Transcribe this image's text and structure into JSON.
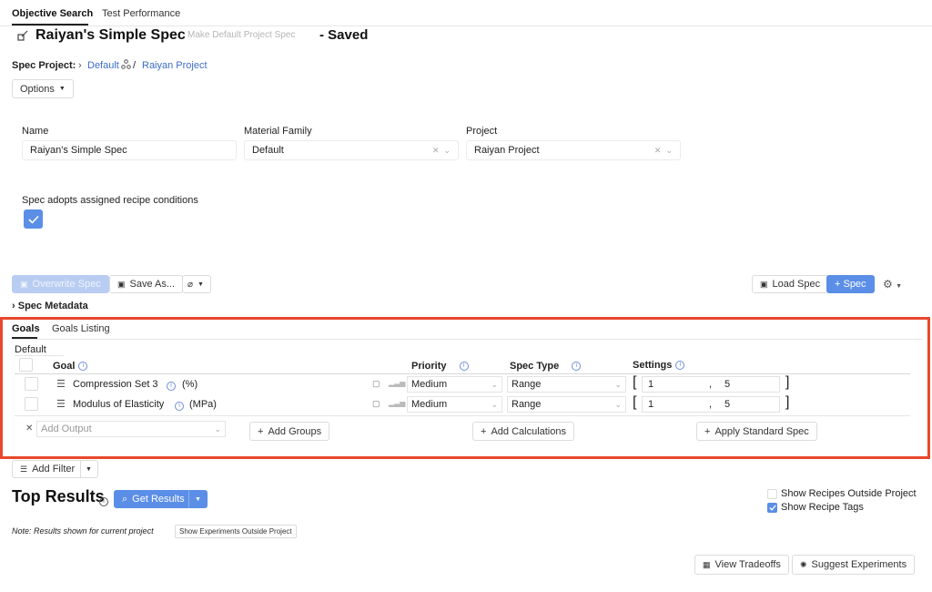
{
  "tabs": [
    {
      "label": "Objective Search",
      "active": true
    },
    {
      "label": "Test Performance",
      "active": false
    }
  ],
  "header": {
    "title": "Raiyan's Simple Spec",
    "make_default": "Make Default Project Spec",
    "saved": "- Saved"
  },
  "breadcrumb": {
    "label": "Spec Project:",
    "default": "Default",
    "separator": "/",
    "project": "Raiyan Project"
  },
  "options_label": "Options",
  "form": {
    "name_label": "Name",
    "name_value": "Raiyan's Simple Spec",
    "material_label": "Material Family",
    "material_value": "Default",
    "project_label": "Project",
    "project_value": "Raiyan Project",
    "adopt_label": "Spec adopts assigned recipe conditions",
    "adopt_checked": true
  },
  "toolbar": {
    "overwrite": "Overwrite Spec",
    "save_as": "Save As...",
    "load": "Load Spec",
    "add_spec": "+ Spec"
  },
  "metadata_label": "Spec Metadata",
  "goals": {
    "tabs": [
      "Goals",
      "Goals Listing"
    ],
    "group": "Default",
    "headers": {
      "goal": "Goal",
      "priority": "Priority",
      "spec_type": "Spec Type",
      "settings": "Settings"
    },
    "rows": [
      {
        "name": "Compression Set 3",
        "unit": "(%)",
        "priority": "Medium",
        "spec_type": "Range",
        "min": "1",
        "max": "5"
      },
      {
        "name": "Modulus of Elasticity",
        "unit": "(MPa)",
        "priority": "Medium",
        "spec_type": "Range",
        "min": "1",
        "max": "5"
      }
    ],
    "add_output_placeholder": "Add Output",
    "add_groups": "Add Groups",
    "add_calculations": "Add Calculations",
    "apply_standard": "Apply Standard Spec"
  },
  "add_filter": "Add Filter",
  "results": {
    "title": "Top Results",
    "get_results": "Get Results",
    "show_outside": "Show Recipes Outside Project",
    "show_outside_checked": false,
    "show_tags": "Show Recipe Tags",
    "show_tags_checked": true,
    "note": "Note: Results shown for current project",
    "show_experiments": "Show Experiments Outside Project",
    "view_tradeoffs": "View Tradeoffs",
    "suggest": "Suggest Experiments"
  },
  "colors": {
    "accent": "#5b8ee6",
    "highlight": "#e8472d"
  }
}
